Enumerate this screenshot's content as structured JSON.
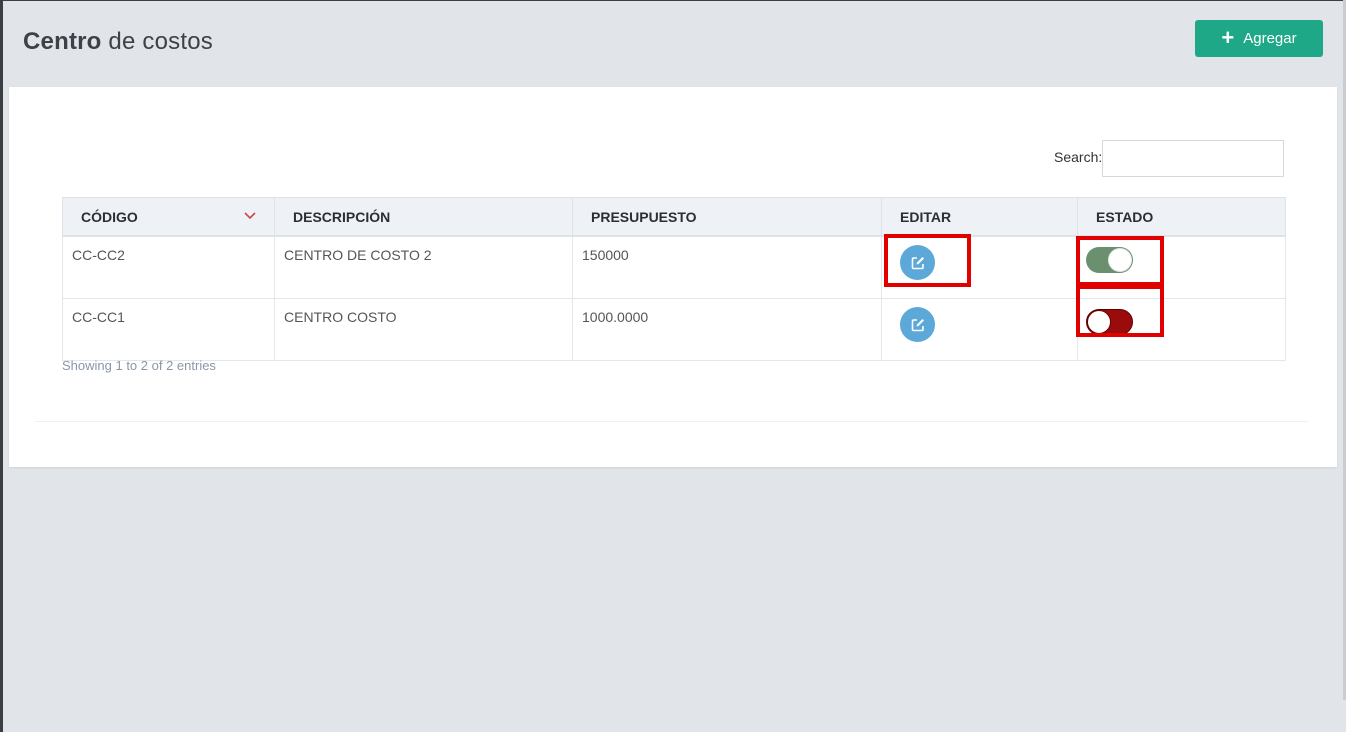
{
  "header": {
    "title_strong": "Centro",
    "title_light": "de costos",
    "add_button_label": "Agregar",
    "add_button_icon": "plus-icon"
  },
  "search": {
    "label": "Search:",
    "value": "",
    "placeholder": ""
  },
  "table": {
    "columns": [
      "CÓDIGO",
      "DESCRIPCIÓN",
      "PRESUPUESTO",
      "EDITAR",
      "ESTADO"
    ],
    "sort_icon": "chevron-down-icon",
    "rows": [
      {
        "codigo": "CC-CC2",
        "descripcion": "CENTRO DE COSTO 2",
        "presupuesto": "150000",
        "edit_icon": "edit-icon",
        "estado": "on"
      },
      {
        "codigo": "CC-CC1",
        "descripcion": "CENTRO COSTO",
        "presupuesto": "1000.0000",
        "edit_icon": "edit-icon",
        "estado": "off"
      }
    ]
  },
  "info": "Showing 1 to 2 of 2 entries",
  "colors": {
    "accent": "#1fa888",
    "edit_button": "#5ba8d9",
    "toggle_on": "#6b9070",
    "toggle_off": "#9a0c0c",
    "highlight": "#e00000"
  }
}
